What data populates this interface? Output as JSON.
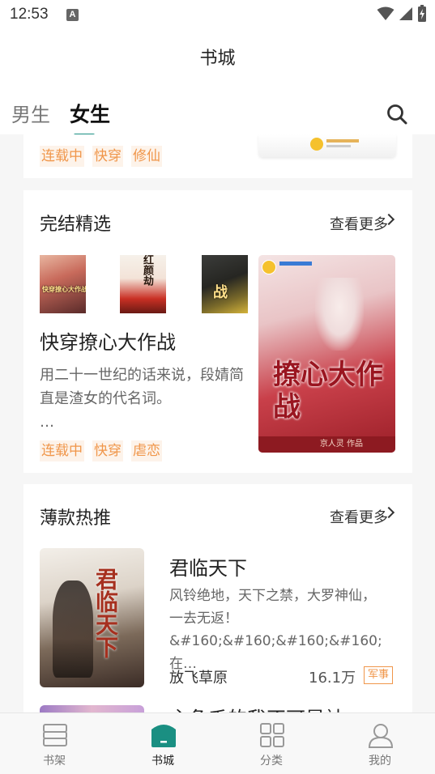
{
  "status_bar": {
    "time": "12:53",
    "notification_badge": "A"
  },
  "header": {
    "title": "书城"
  },
  "tabs": {
    "male": "男生",
    "female": "女生",
    "active": "女生"
  },
  "top_card": {
    "tags": [
      "连载中",
      "快穿",
      "修仙"
    ]
  },
  "finished_section": {
    "title": "完结精选",
    "more_label": "查看更多",
    "small_covers": [
      {
        "cover_text": "快穿撩心大作战"
      },
      {
        "cover_text": "红颜劫"
      },
      {
        "cover_text": "战"
      }
    ],
    "featured": {
      "title": "快穿撩心大作战",
      "description": "用二十一世纪的话来说，段婧简直是渣女的代名词。",
      "ellipsis": "…",
      "tags": [
        "连载中",
        "快穿",
        "虐恋"
      ],
      "cover_title": "撩心大作战",
      "cover_footer": "京人灵 作品"
    }
  },
  "hot_section": {
    "title": "薄款热推",
    "more_label": "查看更多",
    "book": {
      "title": "君临天下",
      "description": "风铃绝地，天下之禁，大罗神仙，一去无返！&#160;&#160;&#160;&#160;在…",
      "author": "放飞草原",
      "word_count": "16.1万",
      "category": "军事",
      "cover_title": "君临天下"
    },
    "next_book_partial_title": "主角千的我不可是社"
  },
  "bottom_nav": [
    {
      "label": "书架",
      "icon": "bookshelf-icon"
    },
    {
      "label": "书城",
      "icon": "bookstore-icon",
      "active": true
    },
    {
      "label": "分类",
      "icon": "category-grid-icon"
    },
    {
      "label": "我的",
      "icon": "profile-icon"
    }
  ],
  "colors": {
    "accent": "#1a8f82",
    "tag": "#f0964a",
    "tag_bg": "#fdf3ea"
  }
}
